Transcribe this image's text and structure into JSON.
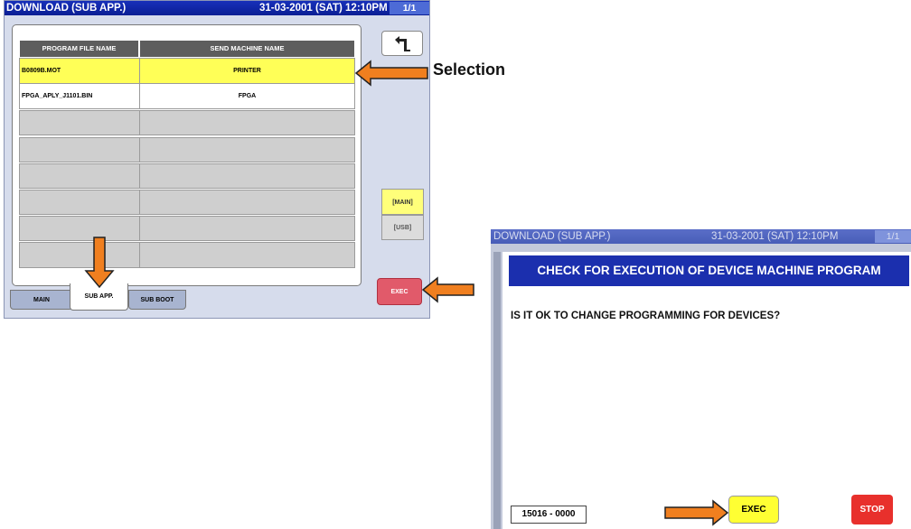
{
  "screen1": {
    "title": "DOWNLOAD (SUB APP.)",
    "datetime": "31-03-2001 (SAT) 12:10PM",
    "page": "1/1",
    "columns": [
      "PROGRAM FILE NAME",
      "SEND MACHINE NAME"
    ],
    "rows": [
      {
        "file": "B0809B.MOT",
        "machine": "PRINTER",
        "selected": true
      },
      {
        "file": "FPGA_APLY_J1101.BIN",
        "machine": "FPGA",
        "selected": false
      },
      {
        "file": "",
        "machine": ""
      },
      {
        "file": "",
        "machine": ""
      },
      {
        "file": "",
        "machine": ""
      },
      {
        "file": "",
        "machine": ""
      },
      {
        "file": "",
        "machine": ""
      },
      {
        "file": "",
        "machine": ""
      }
    ],
    "tabs": [
      "MAIN",
      "SUB APP.",
      "SUB BOOT"
    ],
    "active_tab": "SUB APP.",
    "side_buttons": {
      "main": "[MAIN]",
      "usb": "[USB]"
    },
    "exec": "EXEC",
    "back_icon": "return-arrow-icon"
  },
  "annotation": {
    "selection": "Selection"
  },
  "screen2": {
    "title": "DOWNLOAD (SUB APP.)",
    "datetime": "31-03-2001 (SAT) 12:10PM",
    "page": "1/1",
    "header": "CHECK FOR EXECUTION OF DEVICE MACHINE PROGRAM",
    "question": "IS IT OK TO CHANGE PROGRAMMING FOR DEVICES?",
    "code": "15016 - 0000",
    "exec": "EXEC",
    "stop": "STOP"
  },
  "colors": {
    "title_bar": "#0a1e94",
    "selected_row": "#ffff57",
    "exec_red": "#e15a6a",
    "stop_red": "#e8302c",
    "arrow": "#f07f1f"
  }
}
